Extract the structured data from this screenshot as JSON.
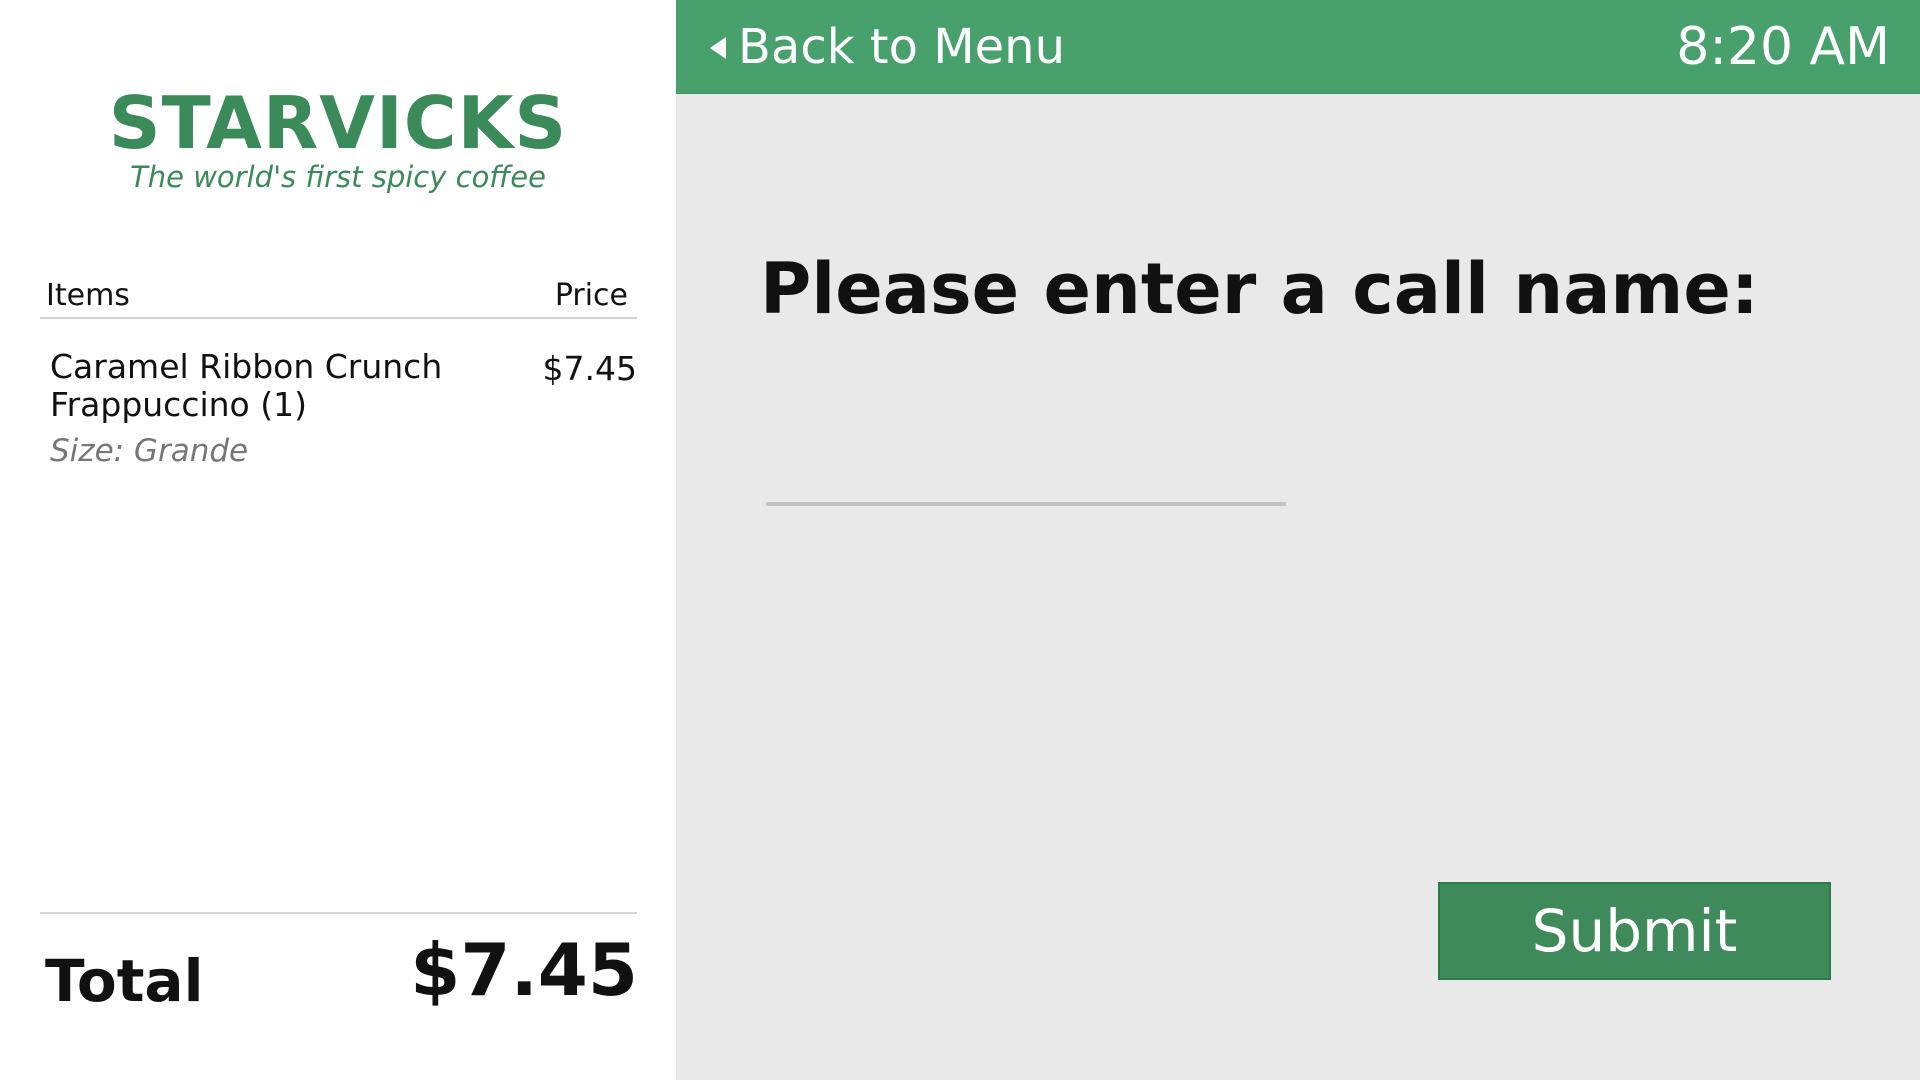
{
  "brand": {
    "name": "STARVICKS",
    "tagline": "The world's first spicy coffee",
    "color": "#3b8a5a"
  },
  "order": {
    "headers": {
      "items": "Items",
      "price": "Price"
    },
    "items": [
      {
        "name": "Caramel Ribbon Crunch Frappuccino (1)",
        "price": "$7.45",
        "size": "Size: Grande"
      }
    ],
    "total_label": "Total",
    "total_value": "$7.45"
  },
  "topbar": {
    "back_label": "Back to Menu",
    "back_icon": "triangle-left-icon",
    "time": "8:20 AM",
    "color": "#48a06c"
  },
  "entry": {
    "prompt": "Please enter a call name:",
    "input_value": "",
    "input_placeholder": "",
    "submit_label": "Submit",
    "submit_color": "#3f8a5b"
  }
}
